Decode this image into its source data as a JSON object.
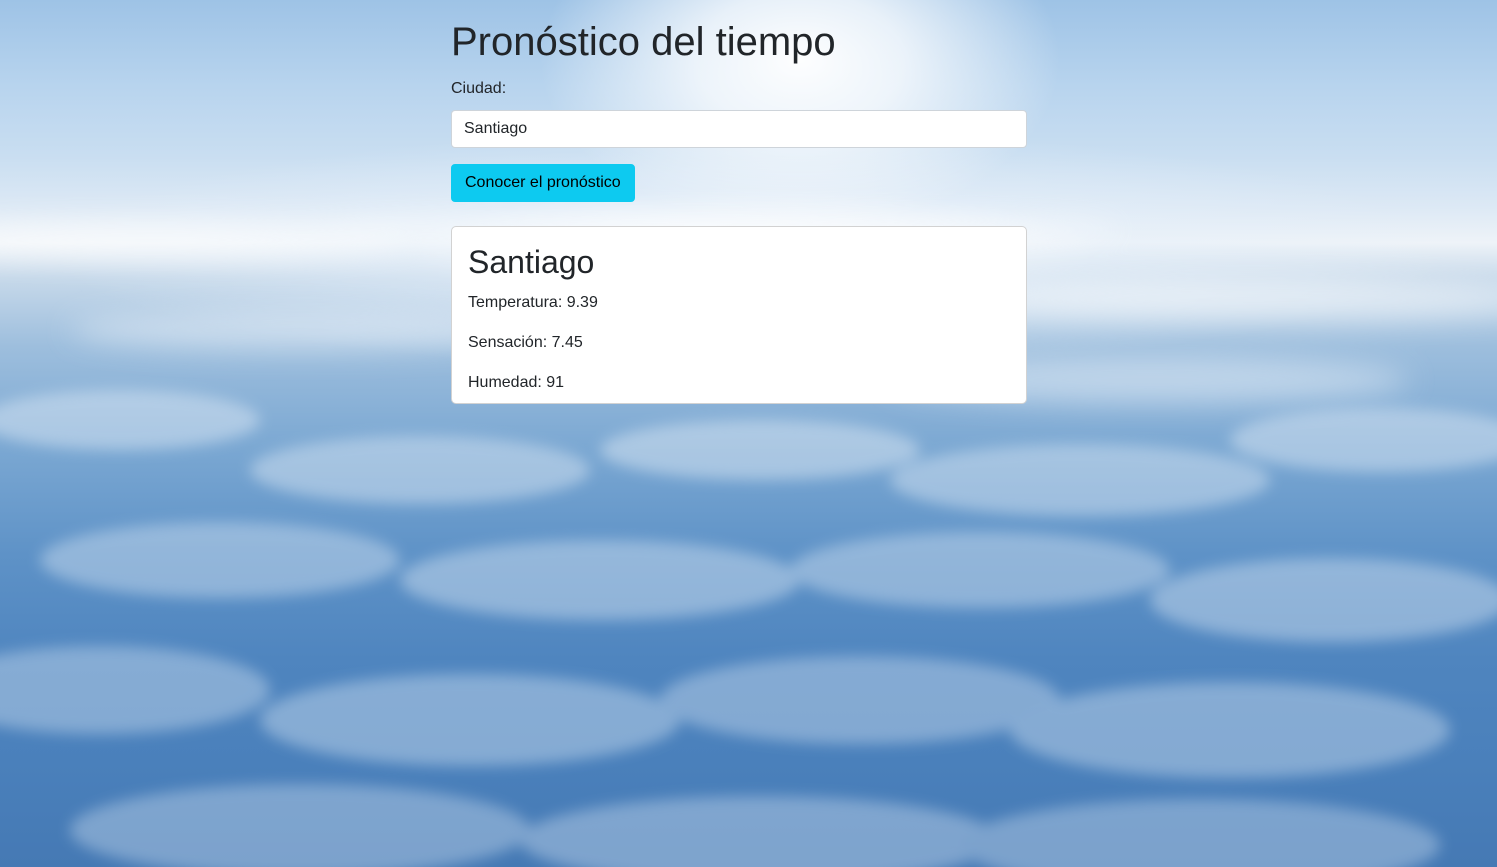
{
  "header": {
    "title": "Pronóstico del tiempo"
  },
  "form": {
    "city_label": "Ciudad:",
    "city_value": "Santiago",
    "submit_label": "Conocer el pronóstico"
  },
  "result": {
    "city": "Santiago",
    "temperature_line": "Temperatura: 9.39",
    "feels_like_line": "Sensación: 7.45",
    "humidity_line": "Humedad: 91"
  },
  "colors": {
    "button_bg": "#0dcaf0",
    "card_bg": "#ffffff",
    "text": "#212529",
    "sky_top": "#9ec3e6",
    "clouds_bottom": "#4579b4"
  }
}
